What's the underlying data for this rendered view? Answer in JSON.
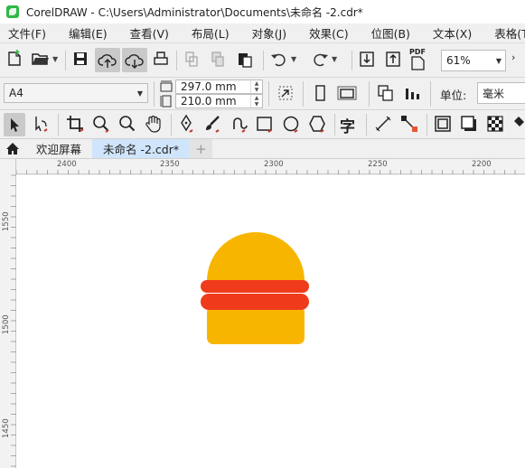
{
  "app": {
    "title": "CorelDRAW - C:\\Users\\Administrator\\Documents\\未命名 -2.cdr*"
  },
  "menu": [
    {
      "label": "文件(F)"
    },
    {
      "label": "编辑(E)"
    },
    {
      "label": "查看(V)"
    },
    {
      "label": "布局(L)"
    },
    {
      "label": "对象(J)"
    },
    {
      "label": "效果(C)"
    },
    {
      "label": "位图(B)"
    },
    {
      "label": "文本(X)"
    },
    {
      "label": "表格(T)"
    }
  ],
  "toolbar": {
    "zoom_value": "61%",
    "pdf_label": "PDF"
  },
  "property_bar": {
    "page_size": "A4",
    "width": "297.0 mm",
    "height": "210.0 mm",
    "units_label": "单位:",
    "units_value": "毫米"
  },
  "tabs": [
    {
      "label": "欢迎屏幕"
    },
    {
      "label": "未命名 -2.cdr*"
    }
  ],
  "ruler": {
    "top_labels": [
      "2400",
      "2350",
      "2300",
      "2250",
      "2200"
    ],
    "left_labels": [
      "1550",
      "1500",
      "1450"
    ]
  },
  "drawing": {
    "bun_color": "#f8b500",
    "filling_color": "#ef3b1b",
    "icons": [
      "burger-bun-top",
      "burger-filling",
      "burger-bun-bottom"
    ]
  },
  "colors": {
    "active_tab": "#cfe5fb",
    "accent_green": "#2fb844"
  }
}
